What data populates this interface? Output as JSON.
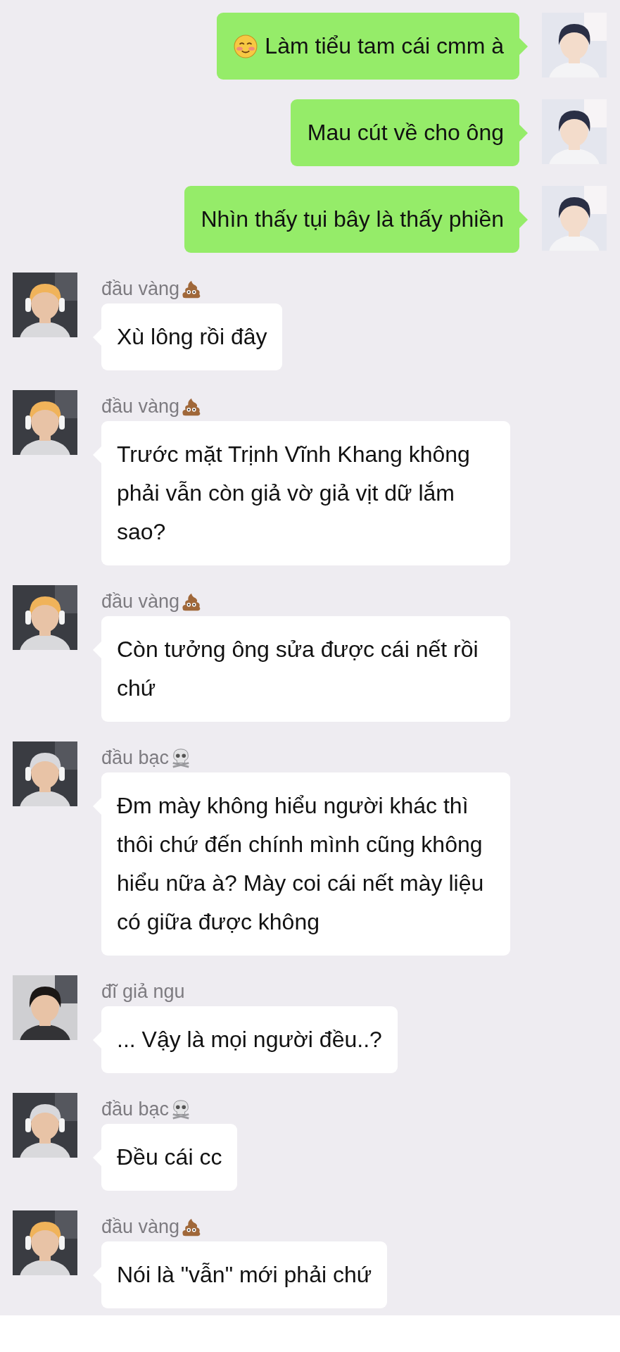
{
  "messages": [
    {
      "kind": "sent",
      "text": "Làm tiểu tam cái cmm à",
      "emoji": {
        "kind": "blush"
      }
    },
    {
      "kind": "sent",
      "text": "Mau cút về cho ông"
    },
    {
      "kind": "sent",
      "text": "Nhìn thấy tụi bây là thấy phiền"
    },
    {
      "kind": "received",
      "sender": "đầu vàng",
      "sender_emoji": {
        "kind": "poop"
      },
      "text": "Xù lông rồi đây"
    },
    {
      "kind": "received",
      "sender": "đầu vàng",
      "sender_emoji": {
        "kind": "poop"
      },
      "text": "Trước mặt Trịnh Vĩnh Khang không phải vẫn còn giả vờ giả vịt dữ lắm sao?"
    },
    {
      "kind": "received",
      "sender": "đầu vàng",
      "sender_emoji": {
        "kind": "poop"
      },
      "text": "Còn tưởng ông sửa được cái nết rồi chứ"
    },
    {
      "kind": "received",
      "sender": "đầu bạc",
      "sender_emoji": {
        "kind": "skull"
      },
      "text": "Đm mày không hiểu người khác thì thôi chứ đến chính mình cũng không hiểu nữa à? Mày coi cái nết mày liệu có giữa được không"
    },
    {
      "kind": "received",
      "sender": "đĩ giả ngu",
      "text": "... Vậy là mọi người đều..?"
    },
    {
      "kind": "received",
      "sender": "đầu bạc",
      "sender_emoji": {
        "kind": "skull"
      },
      "text": "Đều cái cc"
    },
    {
      "kind": "received",
      "sender": "đầu vàng",
      "sender_emoji": {
        "kind": "poop"
      },
      "text": "Nói là \"vẫn\" mới phải chứ"
    }
  ]
}
